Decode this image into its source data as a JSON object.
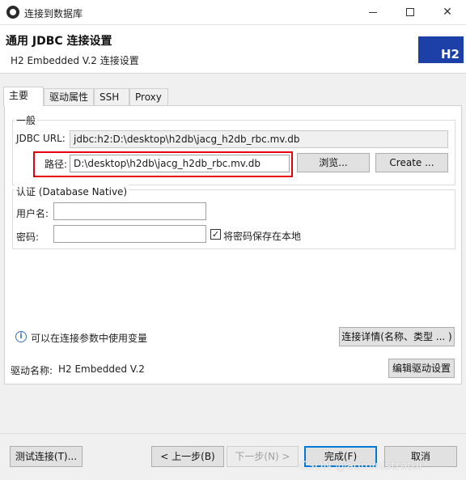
{
  "window": {
    "title": "连接到数据库",
    "controls": {
      "minimize": "—",
      "maximize": "☐",
      "close": "✕"
    }
  },
  "header": {
    "title": "通用 JDBC 连接设置",
    "subtitle": "H2 Embedded V.2 连接设置",
    "logo_text": "H2"
  },
  "tabs": [
    {
      "label": "主要",
      "active": true
    },
    {
      "label": "驱动属性",
      "active": false
    },
    {
      "label": "SSH",
      "active": false
    },
    {
      "label": "Proxy",
      "active": false
    }
  ],
  "general": {
    "group_label": "一般",
    "jdbc_url_label": "JDBC URL:",
    "jdbc_url_value": "jdbc:h2:D:\\desktop\\h2db\\jacg_h2db_rbc.mv.db",
    "path_label": "路径:",
    "path_value": "D:\\desktop\\h2db\\jacg_h2db_rbc.mv.db",
    "browse_button": "浏览...",
    "create_button": "Create ..."
  },
  "auth": {
    "group_label": "认证 (Database Native)",
    "username_label": "用户名:",
    "username_value": "",
    "password_label": "密码:",
    "password_value": "",
    "save_password_label": "将密码保存在本地",
    "save_password_checked": true
  },
  "info": {
    "text": "可以在连接参数中使用变量",
    "details_button": "连接详情(名称、类型 ... )"
  },
  "driver": {
    "label": "驱动名称:",
    "value": "H2 Embedded V.2",
    "edit_button": "编辑驱动设置"
  },
  "footer": {
    "test_button": "测试连接(T)...",
    "back_button": "< 上一步(B)",
    "next_button": "下一步(N) >",
    "finish_button": "完成(F)",
    "cancel_button": "取消"
  },
  "watermark": "CSDN @administrat0r",
  "colors": {
    "highlight": "#e8000b",
    "logo_bg": "#1c3fa8",
    "focus": "#0078d7"
  }
}
